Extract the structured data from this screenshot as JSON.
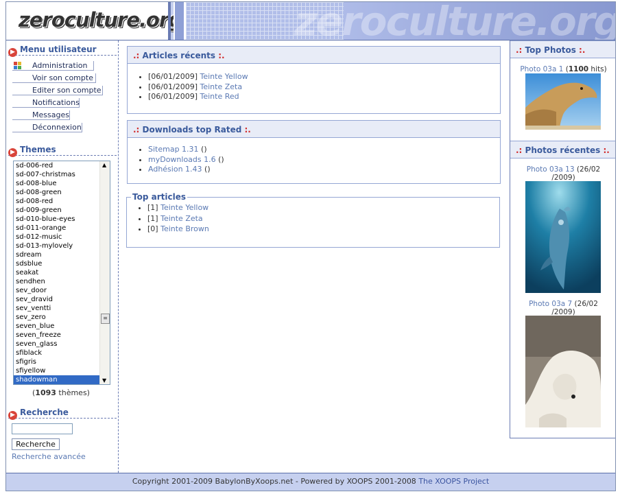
{
  "header": {
    "logo_text": "zeroculture.org",
    "watermark_text": "zeroculture.org"
  },
  "user_menu": {
    "title": "Menu utilisateur",
    "items": [
      {
        "label": "Administration"
      },
      {
        "label": "Voir son compte"
      },
      {
        "label": "Editer son compte"
      },
      {
        "label": "Notifications"
      },
      {
        "label": "Messages"
      },
      {
        "label": "Déconnexion"
      }
    ]
  },
  "themes": {
    "title": "Themes",
    "options": [
      "sd-006-red",
      "sd-007-christmas",
      "sd-008-blue",
      "sd-008-green",
      "sd-008-red",
      "sd-009-green",
      "sd-010-blue-eyes",
      "sd-011-orange",
      "sd-012-music",
      "sd-013-mylovely",
      "sdream",
      "sdsblue",
      "seakat",
      "sendhen",
      "sev_door",
      "sev_dravid",
      "sev_ventti",
      "sev_zero",
      "seven_blue",
      "seven_freeze",
      "seven_glass",
      "sfiblack",
      "sfigris",
      "sfiyellow",
      "shadowman"
    ],
    "selected": "shadowman",
    "count_open": "(",
    "count": "1093",
    "count_label": " thèmes)"
  },
  "search": {
    "title": "Recherche",
    "button": "Recherche",
    "advanced": "Recherche avancée"
  },
  "recent_articles": {
    "title_prefix": ".: ",
    "title": "Articles récents",
    "title_suffix": " :.",
    "items": [
      {
        "date": "[06/01/2009]",
        "link": "Teinte Yellow"
      },
      {
        "date": "[06/01/2009]",
        "link": "Teinte Zeta"
      },
      {
        "date": "[06/01/2009]",
        "link": "Teinte Red"
      }
    ]
  },
  "downloads": {
    "title_prefix": ".: ",
    "title": "Downloads top Rated",
    "title_suffix": " :.",
    "items": [
      {
        "link": "Sitemap 1.31",
        "suffix": " ()"
      },
      {
        "link": "myDownloads 1.6",
        "suffix": " ()"
      },
      {
        "link": "Adhésion 1.43",
        "suffix": " ()"
      }
    ]
  },
  "top_articles": {
    "title": "Top articles",
    "items": [
      {
        "count": "[1]",
        "link": "Teinte Yellow"
      },
      {
        "count": "[1]",
        "link": "Teinte Zeta"
      },
      {
        "count": "[0]",
        "link": "Teinte Brown"
      }
    ]
  },
  "top_photos": {
    "title_prefix": ".: ",
    "title": "Top Photos",
    "title_suffix": " :.",
    "photo_link": "Photo 03a 1",
    "hits_open": " (",
    "hits": "1100",
    "hits_label": " hits)"
  },
  "recent_photos": {
    "title_prefix": ".: ",
    "title": "Photos récentes",
    "title_suffix": " :.",
    "photos": [
      {
        "link": "Photo 03a 13",
        "date_line1": " (26/02",
        "date_line2": "/2009)"
      },
      {
        "link": "Photo 03a 7",
        "date_line1": " (26/02",
        "date_line2": "/2009)"
      }
    ]
  },
  "footer": {
    "text": "Copyright 2001-2009 BabylonByXoops.net - Powered by XOOPS 2001-2008 ",
    "link": "The XOOPS Project"
  },
  "colors": {
    "accent": "#3a5a9c",
    "link": "#5a79b3",
    "header_bg": "#c6d0ef",
    "bullet_red": "#d9443a",
    "selected_bg": "#316ac5"
  }
}
